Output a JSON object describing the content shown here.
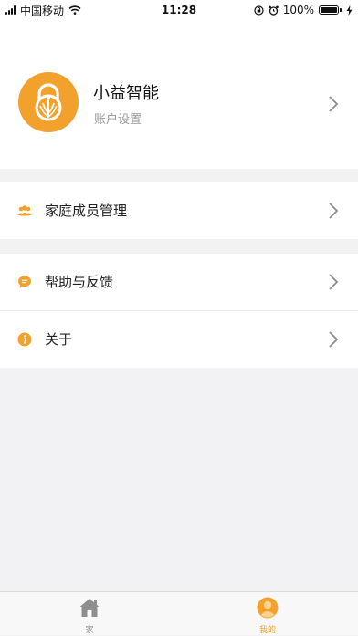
{
  "status_bar": {
    "carrier": "中国移动",
    "time": "11:28",
    "battery": "100%"
  },
  "profile": {
    "name": "小益智能",
    "subtitle": "账户设置",
    "avatar_color": "#f2a12c"
  },
  "menu_groups": [
    {
      "items": [
        {
          "label": "家庭成员管理",
          "icon": "family-members-icon"
        }
      ]
    },
    {
      "items": [
        {
          "label": "帮助与反馈",
          "icon": "chat-bubble-icon"
        },
        {
          "label": "关于",
          "icon": "info-icon"
        }
      ]
    }
  ],
  "tab_bar": {
    "tabs": [
      {
        "label": "家",
        "icon": "home-icon",
        "active": false
      },
      {
        "label": "我的",
        "icon": "person-icon",
        "active": true
      }
    ],
    "active_color": "#f2a12c",
    "inactive_color": "#8e8e8e"
  },
  "colors": {
    "accent": "#f2a12c",
    "background": "#f2f2f5"
  }
}
